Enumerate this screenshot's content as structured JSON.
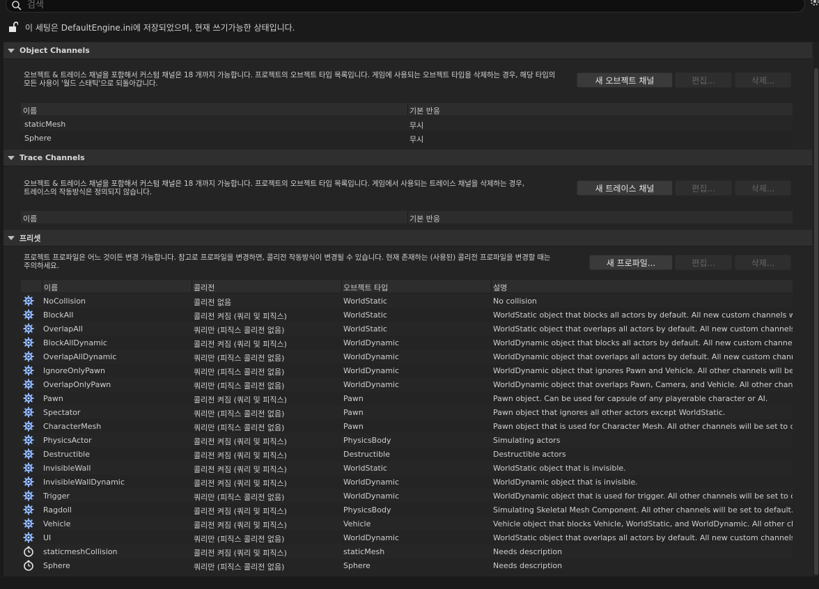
{
  "search": {
    "placeholder": "검색"
  },
  "notice": {
    "text": "이 세팅은 DefaultEngine.ini에 저장되었으며, 현재 쓰기가능한 상태입니다."
  },
  "object_channels": {
    "title": "Object Channels",
    "desc_line1": "오브젝트 & 트레이스 채널을 포함해서 커스텀 채널은 18 개까지 가능합니다. 프로젝트의 오브젝트 타입 목록입니다. 게임에 사용되는 오브젝트 타입을 삭제하는 경우, 해당 타입의",
    "desc_line2": "모든 사용이 '월드 스태틱'으로 되돌아갑니다.",
    "new_button": "새 오브젝트 채널",
    "edit_button": "편집...",
    "delete_button": "삭제...",
    "columns": [
      "이름",
      "기본 반응"
    ],
    "rows": [
      {
        "name": "staticMesh",
        "response": "무시"
      },
      {
        "name": "Sphere",
        "response": "무시"
      }
    ]
  },
  "trace_channels": {
    "title": "Trace Channels",
    "desc_line1": "오브젝트 & 트레이스 채널을 포함해서 커스텀 채널은 18 개까지 가능합니다. 프로젝트의 오브젝트 타입 목록입니다. 게임에서 사용되는 트레이스 채널을 삭제하는 경우,",
    "desc_line2": "트레이스의 작동방식은 정의되지 않습니다.",
    "new_button": "새 트레이스 채널",
    "edit_button": "편집...",
    "delete_button": "삭제...",
    "columns": [
      "이름",
      "기본 반응"
    ]
  },
  "presets": {
    "title": "프리셋",
    "desc_line1": "프로젝트 프로파일은 어느 것이든 변경 가능합니다. 참고로 프로파일을 변경하면, 콜리전 작동방식이 변경될 수 있습니다. 현재 존재하는 (사용된) 콜리전 프로파일을 변경할 때는",
    "desc_line2": "주의하세요.",
    "new_button": "새 프로파일...",
    "edit_button": "편집...",
    "delete_button": "삭제...",
    "columns": [
      "이름",
      "콜리전",
      "오브젝트 타입",
      "설명"
    ],
    "rows": [
      {
        "icon": "engine-gear-icon",
        "name": "NoCollision",
        "collision": "콜리전 없음",
        "type": "WorldStatic",
        "desc": "No collision"
      },
      {
        "icon": "engine-gear-icon",
        "name": "BlockAll",
        "collision": "콜리전 켜짐 (쿼리 및 피직스)",
        "type": "WorldStatic",
        "desc": "WorldStatic object that blocks all actors by default. All new custom channels will use i"
      },
      {
        "icon": "engine-gear-icon",
        "name": "OverlapAll",
        "collision": "쿼리만 (피직스 콜리전 없음)",
        "type": "WorldStatic",
        "desc": "WorldStatic object that overlaps all actors by default. All new custom channels will us"
      },
      {
        "icon": "engine-gear-icon",
        "name": "BlockAllDynamic",
        "collision": "콜리전 켜짐 (쿼리 및 피직스)",
        "type": "WorldDynamic",
        "desc": "WorldDynamic object that blocks all actors by default. All new custom channels will us"
      },
      {
        "icon": "engine-gear-icon",
        "name": "OverlapAllDynamic",
        "collision": "쿼리만 (피직스 콜리전 없음)",
        "type": "WorldDynamic",
        "desc": "WorldDynamic object that overlaps all actors by default. All new custom channels will"
      },
      {
        "icon": "engine-gear-icon",
        "name": "IgnoreOnlyPawn",
        "collision": "쿼리만 (피직스 콜리전 없음)",
        "type": "WorldDynamic",
        "desc": "WorldDynamic object that ignores Pawn and Vehicle. All other channels will be set to d"
      },
      {
        "icon": "engine-gear-icon",
        "name": "OverlapOnlyPawn",
        "collision": "쿼리만 (피직스 콜리전 없음)",
        "type": "WorldDynamic",
        "desc": "WorldDynamic object that overlaps Pawn, Camera, and Vehicle. All other channels will"
      },
      {
        "icon": "engine-gear-icon",
        "name": "Pawn",
        "collision": "콜리전 켜짐 (쿼리 및 피직스)",
        "type": "Pawn",
        "desc": "Pawn object. Can be used for capsule of any playerable character or AI."
      },
      {
        "icon": "engine-gear-icon",
        "name": "Spectator",
        "collision": "쿼리만 (피직스 콜리전 없음)",
        "type": "Pawn",
        "desc": "Pawn object that ignores all other actors except WorldStatic."
      },
      {
        "icon": "engine-gear-icon",
        "name": "CharacterMesh",
        "collision": "쿼리만 (피직스 콜리전 없음)",
        "type": "Pawn",
        "desc": "Pawn object that is used for Character Mesh. All other channels will be set to default."
      },
      {
        "icon": "engine-gear-icon",
        "name": "PhysicsActor",
        "collision": "콜리전 켜짐 (쿼리 및 피직스)",
        "type": "PhysicsBody",
        "desc": "Simulating actors"
      },
      {
        "icon": "engine-gear-icon",
        "name": "Destructible",
        "collision": "콜리전 켜짐 (쿼리 및 피직스)",
        "type": "Destructible",
        "desc": "Destructible actors"
      },
      {
        "icon": "engine-gear-icon",
        "name": "InvisibleWall",
        "collision": "콜리전 켜짐 (쿼리 및 피직스)",
        "type": "WorldStatic",
        "desc": "WorldStatic object that is invisible."
      },
      {
        "icon": "engine-gear-icon",
        "name": "InvisibleWallDynamic",
        "collision": "콜리전 켜짐 (쿼리 및 피직스)",
        "type": "WorldDynamic",
        "desc": "WorldDynamic object that is invisible."
      },
      {
        "icon": "engine-gear-icon",
        "name": "Trigger",
        "collision": "쿼리만 (피직스 콜리전 없음)",
        "type": "WorldDynamic",
        "desc": "WorldDynamic object that is used for trigger. All other channels will be set to default."
      },
      {
        "icon": "engine-gear-icon",
        "name": "Ragdoll",
        "collision": "콜리전 켜짐 (쿼리 및 피직스)",
        "type": "PhysicsBody",
        "desc": "Simulating Skeletal Mesh Component. All other channels will be set to default."
      },
      {
        "icon": "engine-gear-icon",
        "name": "Vehicle",
        "collision": "콜리전 켜짐 (쿼리 및 피직스)",
        "type": "Vehicle",
        "desc": "Vehicle object that blocks Vehicle, WorldStatic, and WorldDynamic. All other channels"
      },
      {
        "icon": "engine-gear-icon",
        "name": "UI",
        "collision": "쿼리만 (피직스 콜리전 없음)",
        "type": "WorldDynamic",
        "desc": "WorldStatic object that overlaps all actors by default. All new custom channels will us"
      },
      {
        "icon": "stopwatch-icon",
        "name": "staticmeshCollision",
        "collision": "콜리전 켜짐 (쿼리 및 피직스)",
        "type": "staticMesh",
        "desc": "Needs description"
      },
      {
        "icon": "stopwatch-icon",
        "name": "Sphere",
        "collision": "쿼리만 (피직스 콜리전 없음)",
        "type": "Sphere",
        "desc": "Needs description"
      }
    ]
  }
}
